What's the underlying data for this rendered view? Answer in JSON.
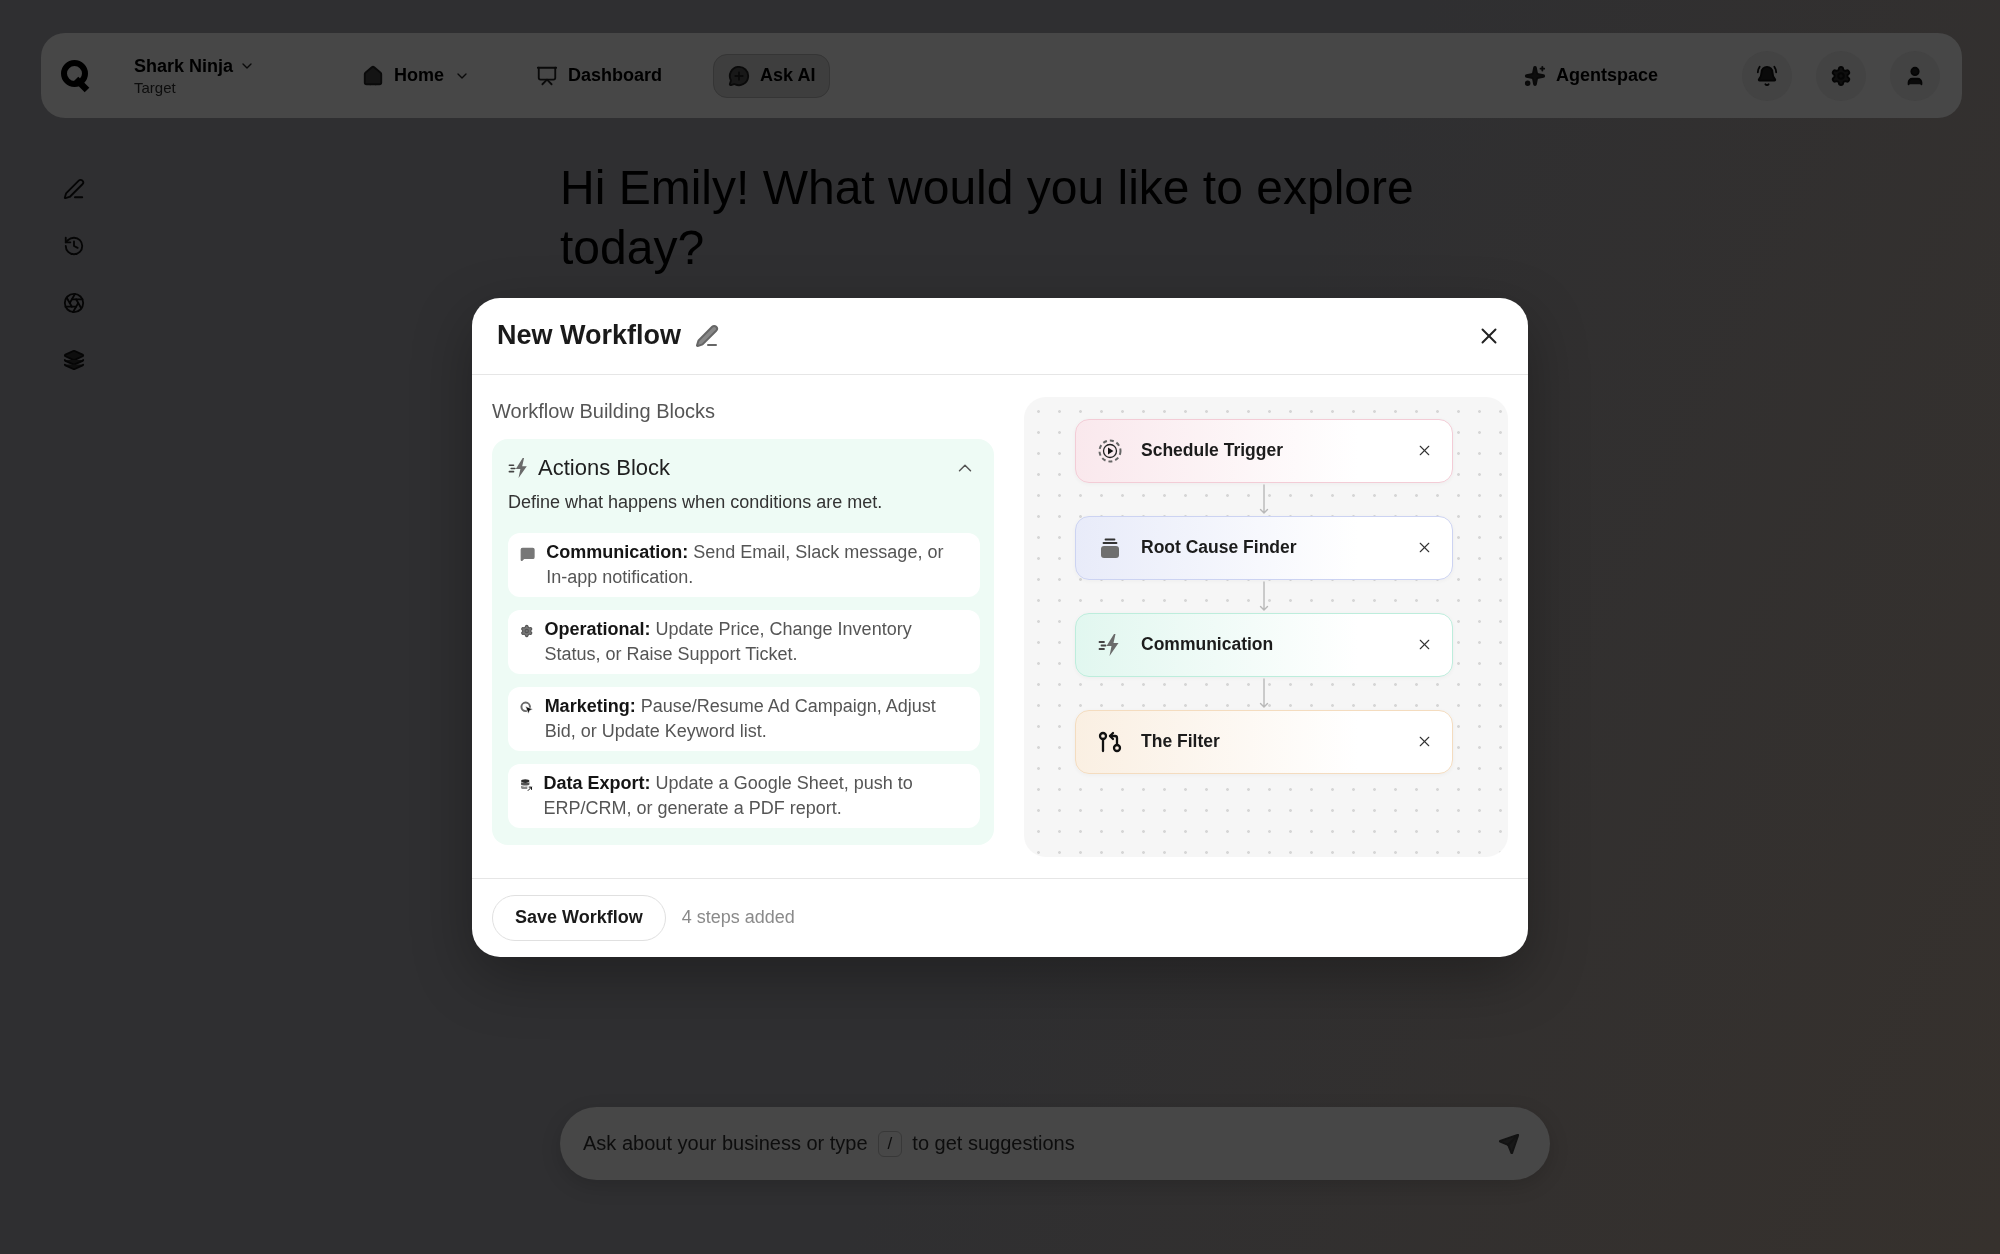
{
  "topbar": {
    "workspace": {
      "name": "Shark Ninja",
      "subtitle": "Target"
    },
    "nav": [
      {
        "label": "Home",
        "selected": false,
        "dropdown": true
      },
      {
        "label": "Dashboard",
        "selected": false,
        "dropdown": false
      },
      {
        "label": "Ask AI",
        "selected": true,
        "dropdown": false
      }
    ],
    "agentspace": "Agentspace"
  },
  "greeting": "Hi Emily! What would you like to explore today?",
  "prompt": {
    "placeholder": "Ask about your business or type",
    "shortcut": "/",
    "placeholder_end": "to get suggestions"
  },
  "modal": {
    "title": "New Workflow",
    "section_title": "Workflow Building Blocks",
    "block": {
      "title": "Actions Block",
      "expanded": true,
      "description": "Define what happens when conditions are met.",
      "items": [
        {
          "text": "**Communication:** Send Email, Slack message, or In-app notification."
        },
        {
          "text": "**Operational:** Update Price, Change Inventory Status, or Raise Support Ticket."
        },
        {
          "text": "**Marketing:** Pause/Resume Ad Campaign, Adjust Bid, or Update Keyword list."
        },
        {
          "text": "**Data Export:** Update a Google Sheet, push to ERP/CRM, or generate a PDF report."
        }
      ]
    },
    "steps": [
      {
        "label": "Schedule Trigger",
        "color": "#f3ccd6"
      },
      {
        "label": "Root Cause Finder",
        "color": "#ccd3f2"
      },
      {
        "label": "Communication",
        "color": "#bdeddc"
      },
      {
        "label": "The Filter",
        "color": "#f4dcbf"
      }
    ],
    "save_button": "Save Workflow",
    "status": "4 steps added"
  }
}
